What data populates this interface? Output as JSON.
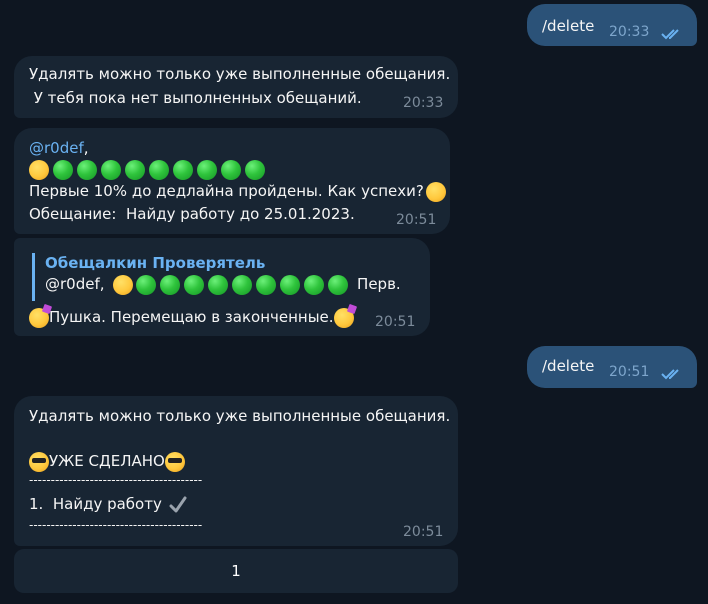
{
  "messages": [
    {
      "text": "/delete",
      "time": "20:33"
    },
    {
      "lines": [
        "Удалять можно только уже выполненные обещания.",
        " У тебя пока нет выполненных обещаний."
      ],
      "time": "20:33"
    },
    {
      "mention": "@r0def",
      "mention_suffix": ",",
      "line2": "Первые 10% до дедлайна пройдены. Как успехи?",
      "line3": "Обещание:  Найду работу до 25.01.2023.",
      "time": "20:51"
    },
    {
      "quote_name": "Обещалкин Проверятель",
      "quote_prefix": "@r0def, ",
      "quote_suffix": " Перв...",
      "text": "Пушка. Перемещаю в законченные.",
      "time": "20:51"
    },
    {
      "text": "/delete",
      "time": "20:51"
    },
    {
      "line1": "Удалять можно только уже выполненные обещания.",
      "line2": "УЖЕ СДЕЛАНО",
      "sep1": "----------------------------------------",
      "line3": "1.  Найду работу",
      "sep2": "----------------------------------------",
      "time": "20:51"
    }
  ],
  "keyboard": {
    "button": "1"
  },
  "icons": {
    "read": "double-check-icon",
    "done": "check-mark-icon",
    "green": "green-circle-emoji",
    "shush": "shushing-face-emoji",
    "relieved": "relieved-face-emoji",
    "party": "partying-face-emoji",
    "cool": "sunglasses-face-emoji"
  }
}
